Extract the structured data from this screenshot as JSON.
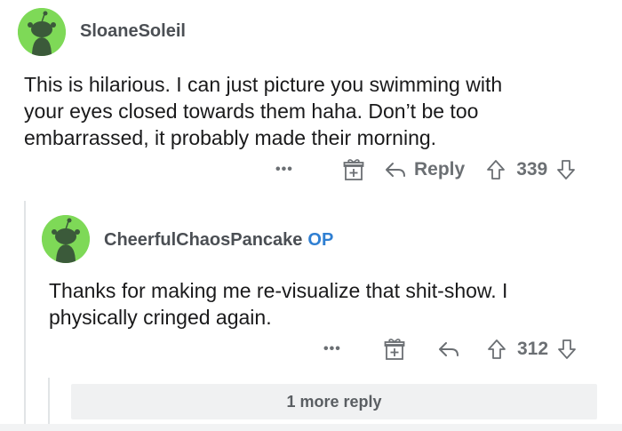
{
  "comment": {
    "username": "SloaneSoleil",
    "body_line1": "This is hilarious. I can just picture you swimming with",
    "body_line2": "your eyes closed towards them haha. Don’t be too",
    "body_line3": "embarrassed, it probably made their morning.",
    "more_label": "•••",
    "reply_label": "Reply",
    "score": "339"
  },
  "reply": {
    "username": "CheerfulChaosPancake",
    "op_badge": "OP",
    "body_line1": "Thanks for making me re-visualize that shit-show. I",
    "body_line2": "physically cringed again.",
    "more_label": "•••",
    "score": "312"
  },
  "more_replies": {
    "label": "1 more reply"
  },
  "colors": {
    "avatar_bg": "#7ed957",
    "op": "#2f7fd2",
    "muted": "#6b6f73"
  }
}
